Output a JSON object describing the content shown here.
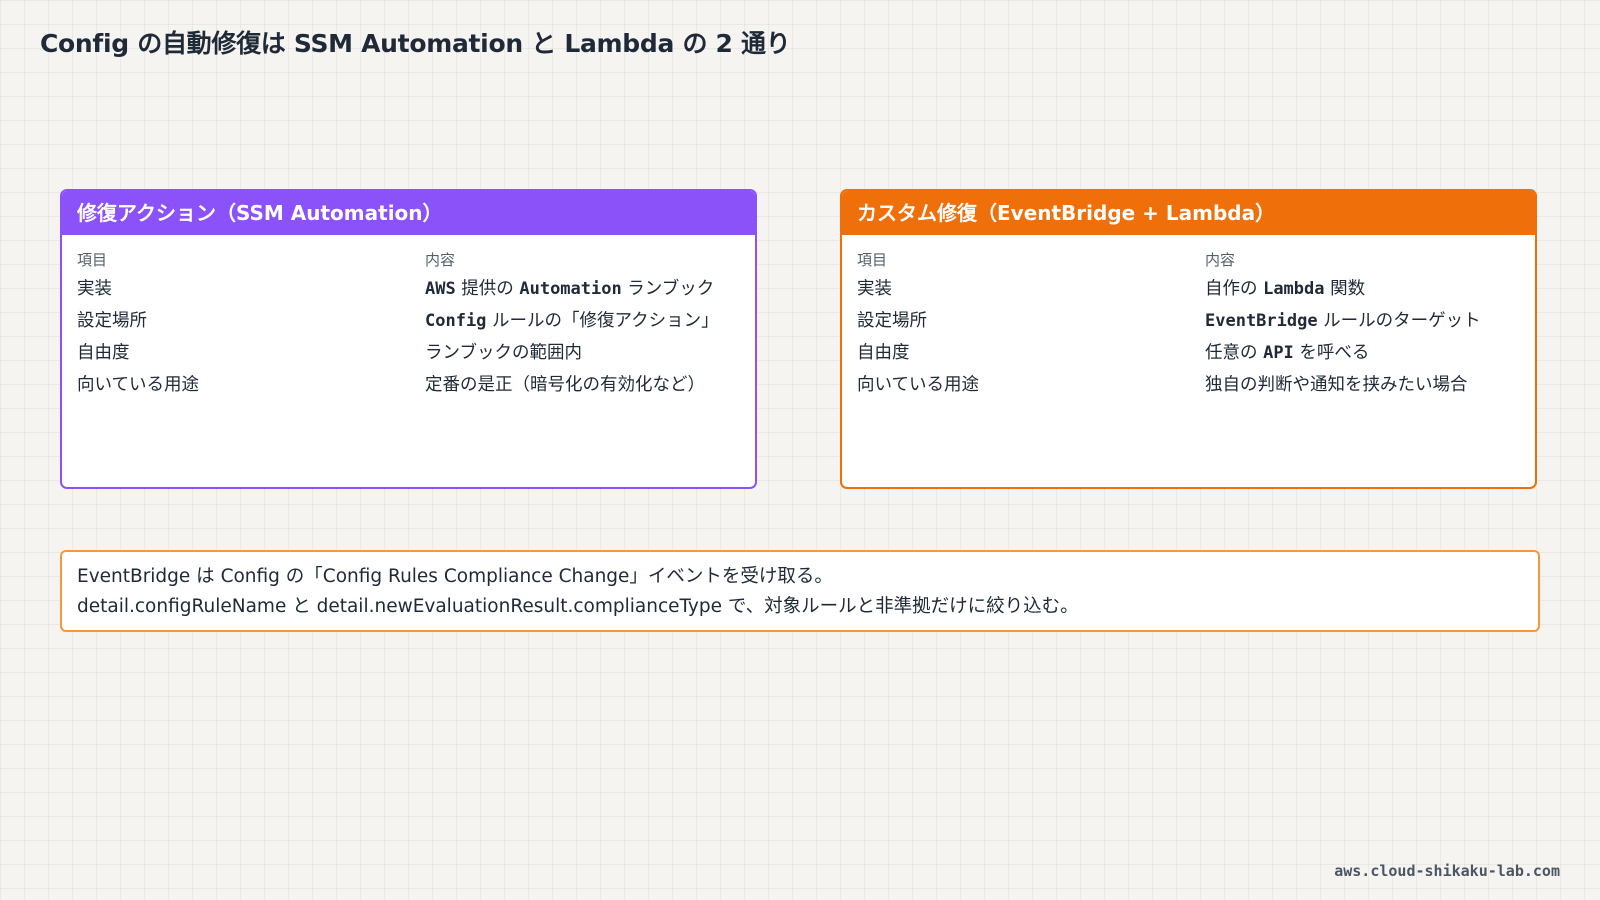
{
  "title": "Config の自動修復は SSM Automation と Lambda の 2 通り",
  "colors": {
    "ssm_accent": "#8b52fa",
    "lambda_accent": "#ef700a",
    "note_border": "#f29a3a",
    "background": "#f5f4f0"
  },
  "cards": [
    {
      "header": "修復アクション（SSM Automation）",
      "col_item": "項目",
      "col_content": "内容",
      "rows": [
        {
          "item": "実装",
          "content": [
            {
              "t": "AWS",
              "code": true
            },
            {
              "t": " 提供の "
            },
            {
              "t": "Automation",
              "code": true
            },
            {
              "t": " ランブック"
            }
          ]
        },
        {
          "item": "設定場所",
          "content": [
            {
              "t": "Config",
              "code": true
            },
            {
              "t": " ルールの「修復アクション」"
            }
          ]
        },
        {
          "item": "自由度",
          "content": [
            {
              "t": "ランブックの範囲内"
            }
          ]
        },
        {
          "item": "向いている用途",
          "content": [
            {
              "t": "定番の是正（暗号化の有効化など）"
            }
          ]
        }
      ]
    },
    {
      "header": "カスタム修復（EventBridge + Lambda）",
      "col_item": "項目",
      "col_content": "内容",
      "rows": [
        {
          "item": "実装",
          "content": [
            {
              "t": "自作の "
            },
            {
              "t": "Lambda",
              "code": true
            },
            {
              "t": " 関数"
            }
          ]
        },
        {
          "item": "設定場所",
          "content": [
            {
              "t": "EventBridge",
              "code": true
            },
            {
              "t": " ルールのターゲット"
            }
          ]
        },
        {
          "item": "自由度",
          "content": [
            {
              "t": "任意の "
            },
            {
              "t": "API",
              "code": true
            },
            {
              "t": " を呼べる"
            }
          ]
        },
        {
          "item": "向いている用途",
          "content": [
            {
              "t": "独自の判断や通知を挟みたい場合"
            }
          ]
        }
      ]
    }
  ],
  "note": {
    "line1": "EventBridge は Config の「Config Rules Compliance Change」イベントを受け取る。",
    "line2": "detail.configRuleName と detail.newEvaluationResult.complianceType で、対象ルールと非準拠だけに絞り込む。"
  },
  "footer": "aws.cloud-shikaku-lab.com"
}
